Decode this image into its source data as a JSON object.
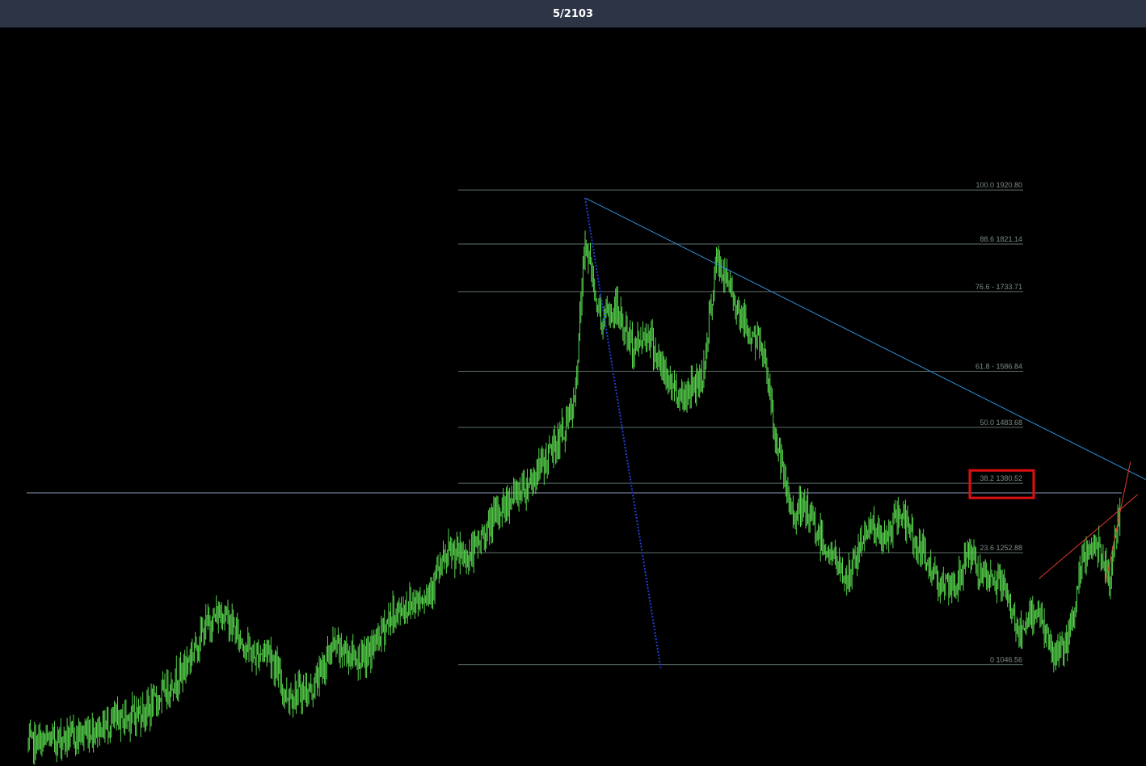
{
  "topbar": {
    "title": "5/2103"
  },
  "colors": {
    "background": "#000000",
    "topbar": "#2c3446",
    "bars": "#56d34c",
    "fib_line": "#5f6f6a",
    "fib_text": "#7c8c86",
    "trendline": "#2f8fd6",
    "horizontal_line": "#8a9ab0",
    "dotted_line": "#1f3fd8",
    "red_lines": "#e03a2a",
    "highlight_box": "#e01010"
  },
  "chart_data": {
    "type": "bar",
    "ylim": [
      860,
      2220
    ],
    "grid": false,
    "legend": "none",
    "price_path": [
      [
        0,
        900
      ],
      [
        45,
        915
      ],
      [
        115,
        965
      ],
      [
        145,
        1030
      ],
      [
        170,
        1120
      ],
      [
        185,
        1145
      ],
      [
        200,
        1100
      ],
      [
        215,
        1060
      ],
      [
        228,
        1080
      ],
      [
        245,
        990
      ],
      [
        270,
        1000
      ],
      [
        290,
        1080
      ],
      [
        320,
        1055
      ],
      [
        345,
        1135
      ],
      [
        380,
        1180
      ],
      [
        400,
        1250
      ],
      [
        420,
        1245
      ],
      [
        450,
        1335
      ],
      [
        480,
        1390
      ],
      [
        505,
        1460
      ],
      [
        520,
        1525
      ],
      [
        530,
        1830
      ],
      [
        545,
        1680
      ],
      [
        560,
        1700
      ],
      [
        575,
        1630
      ],
      [
        590,
        1660
      ],
      [
        605,
        1580
      ],
      [
        622,
        1540
      ],
      [
        642,
        1580
      ],
      [
        655,
        1790
      ],
      [
        668,
        1740
      ],
      [
        685,
        1660
      ],
      [
        700,
        1630
      ],
      [
        710,
        1480
      ],
      [
        725,
        1330
      ],
      [
        740,
        1330
      ],
      [
        760,
        1260
      ],
      [
        780,
        1200
      ],
      [
        800,
        1310
      ],
      [
        815,
        1270
      ],
      [
        830,
        1330
      ],
      [
        845,
        1270
      ],
      [
        860,
        1220
      ],
      [
        880,
        1175
      ],
      [
        895,
        1260
      ],
      [
        910,
        1195
      ],
      [
        925,
        1205
      ],
      [
        945,
        1095
      ],
      [
        960,
        1155
      ],
      [
        975,
        1065
      ],
      [
        990,
        1085
      ],
      [
        1005,
        1250
      ],
      [
        1018,
        1270
      ],
      [
        1030,
        1210
      ],
      [
        1040,
        1350
      ]
    ],
    "fib_levels": [
      {
        "label": "100.0 1920.80",
        "value": 1920.8
      },
      {
        "label": "88.6 1821.14",
        "value": 1821.14
      },
      {
        "label": "76.6 - 1733.71",
        "value": 1733.71
      },
      {
        "label": "61.8 - 1586.84",
        "value": 1586.84
      },
      {
        "label": "50.0 1483.68",
        "value": 1483.68
      },
      {
        "label": "38.2 1380.52",
        "value": 1380.52
      },
      {
        "label": "23.6 1252.88",
        "value": 1252.88
      },
      {
        "label": "0 1046.56",
        "value": 1046.56
      }
    ],
    "highlighted_level": "38.2 1380.52",
    "horizontal_line_value": 1363,
    "trendline": {
      "start": [
        530,
        1906
      ],
      "end": [
        1128,
        1325
      ]
    },
    "dotted_line": {
      "start": [
        530,
        1906
      ],
      "end": [
        602,
        1040
      ]
    },
    "red_lines": [
      {
        "start": [
          962,
          1205
        ],
        "end": [
          1056,
          1360
        ]
      },
      {
        "start": [
          1025,
          1195
        ],
        "end": [
          1049,
          1420
        ]
      }
    ]
  }
}
